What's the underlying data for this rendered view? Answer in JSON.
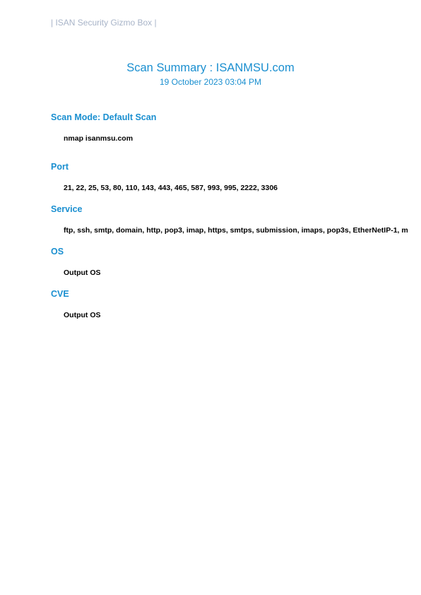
{
  "header": {
    "text": "| ISAN Security Gizmo Box |"
  },
  "title_block": {
    "title": "Scan Summary : ISANMSU.com",
    "date": "19 October 2023 03:04 PM"
  },
  "sections": {
    "scan_mode": {
      "heading": "Scan Mode: Default Scan",
      "body": "nmap  isanmsu.com"
    },
    "port": {
      "heading": "Port",
      "body": "21, 22, 25, 53, 80, 110, 143, 443, 465, 587, 993, 995, 2222, 3306"
    },
    "service": {
      "heading": "Service",
      "body": "ftp, ssh, smtp, domain, http, pop3, imap, https, smtps, submission, imaps, pop3s, EtherNetIP-1, m"
    },
    "os": {
      "heading": "OS",
      "body": "Output OS"
    },
    "cve": {
      "heading": "CVE",
      "body": "Output OS"
    }
  },
  "colors": {
    "accent": "#1a8fd0",
    "header_gray": "#a8b4c8",
    "body_text": "#000000"
  }
}
